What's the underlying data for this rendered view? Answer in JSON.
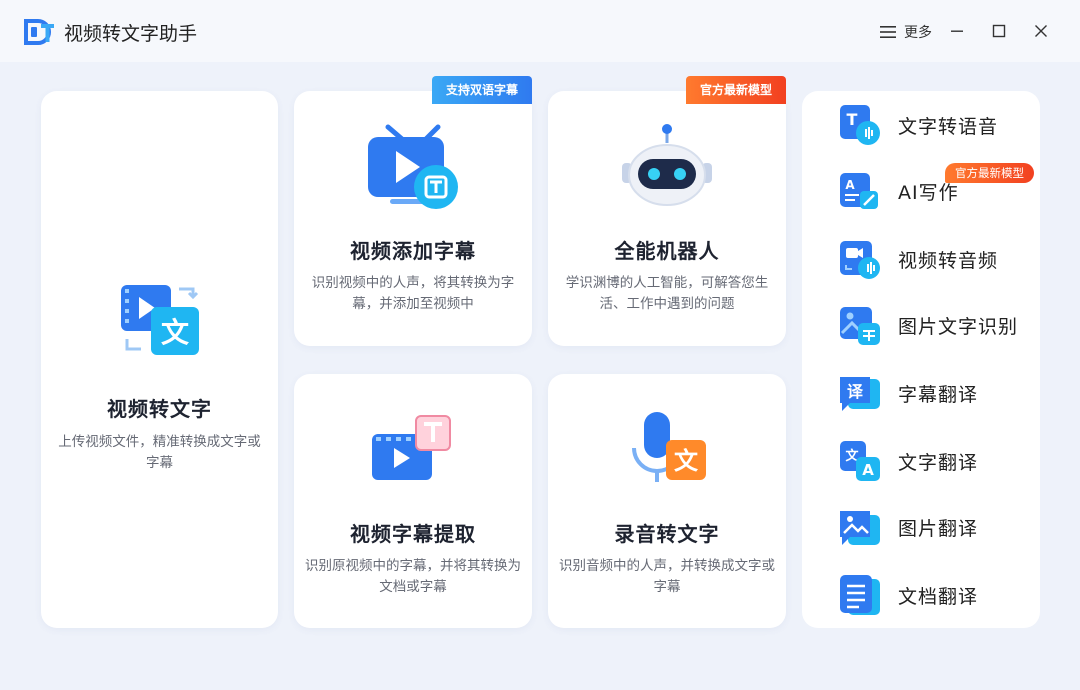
{
  "app": {
    "title": "视频转文字助手",
    "more_label": "更多"
  },
  "colors": {
    "accent_blue": "#2f7af0",
    "badge_red": "#f24020",
    "background": "#eef2fa"
  },
  "main_card": {
    "title": "视频转文字",
    "desc": "上传视频文件，精准转换成文字或字幕",
    "icon": "video-to-text-icon"
  },
  "cards": [
    {
      "title": "视频添加字幕",
      "desc": "识别视频中的人声，将其转换为字幕，并添加至视频中",
      "badge": "支持双语字幕",
      "icon": "tv-subtitle-icon"
    },
    {
      "title": "全能机器人",
      "desc": "学识渊博的人工智能，可解答您生活、工作中遇到的问题",
      "badge": "官方最新模型",
      "icon": "robot-icon"
    },
    {
      "title": "视频字幕提取",
      "desc": "识别原视频中的字幕，并将其转换为文档或字幕",
      "icon": "subtitle-extract-icon"
    },
    {
      "title": "录音转文字",
      "desc": "识别音频中的人声，并转换成文字或字幕",
      "icon": "microphone-icon"
    }
  ],
  "side_items": [
    {
      "label": "文字转语音",
      "icon": "text-to-speech-icon"
    },
    {
      "label": "AI写作",
      "icon": "ai-writing-icon",
      "badge": "官方最新模型"
    },
    {
      "label": "视频转音频",
      "icon": "video-to-audio-icon"
    },
    {
      "label": "图片文字识别",
      "icon": "image-ocr-icon"
    },
    {
      "label": "字幕翻译",
      "icon": "subtitle-translate-icon"
    },
    {
      "label": "文字翻译",
      "icon": "text-translate-icon"
    },
    {
      "label": "图片翻译",
      "icon": "image-translate-icon"
    },
    {
      "label": "文档翻译",
      "icon": "document-translate-icon"
    }
  ]
}
